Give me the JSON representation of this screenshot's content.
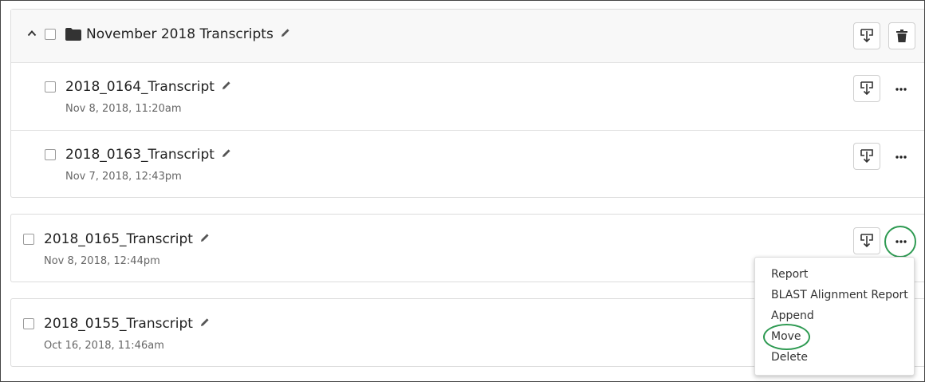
{
  "folder": {
    "title": "November 2018 Transcripts",
    "items": [
      {
        "title": "2018_0164_Transcript",
        "date": "Nov 8, 2018, 11:20am"
      },
      {
        "title": "2018_0163_Transcript",
        "date": "Nov 7, 2018, 12:43pm"
      }
    ]
  },
  "items": [
    {
      "title": "2018_0165_Transcript",
      "date": "Nov 8, 2018, 12:44pm"
    },
    {
      "title": "2018_0155_Transcript",
      "date": "Oct 16, 2018, 11:46am"
    }
  ],
  "menu": {
    "items": [
      "Report",
      "BLAST Alignment Report",
      "Append",
      "Move",
      "Delete"
    ]
  },
  "colors": {
    "highlight": "#2e9a52"
  },
  "icons": {
    "collapse": "chevron-up-icon",
    "folder": "folder-icon",
    "edit": "pencil-icon",
    "download": "download-icon",
    "delete": "trash-icon",
    "more": "ellipsis-icon"
  }
}
